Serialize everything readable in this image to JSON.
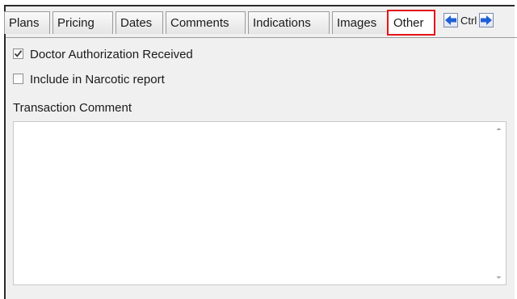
{
  "tabs": [
    {
      "label": "Plans"
    },
    {
      "label": "Pricing"
    },
    {
      "label": "Dates"
    },
    {
      "label": "Comments"
    },
    {
      "label": "Indications"
    },
    {
      "label": "Images"
    },
    {
      "label": "Other",
      "active": true
    }
  ],
  "nav": {
    "ctrl_label": "Ctrl"
  },
  "options": [
    {
      "label": "Doctor Authorization Received",
      "checked": true
    },
    {
      "label": "Include in Narcotic report",
      "checked": false
    }
  ],
  "comment": {
    "label": "Transaction Comment",
    "value": ""
  },
  "colors": {
    "active_tab_border": "#e5141a",
    "nav_arrow": "#1f5fd6"
  }
}
